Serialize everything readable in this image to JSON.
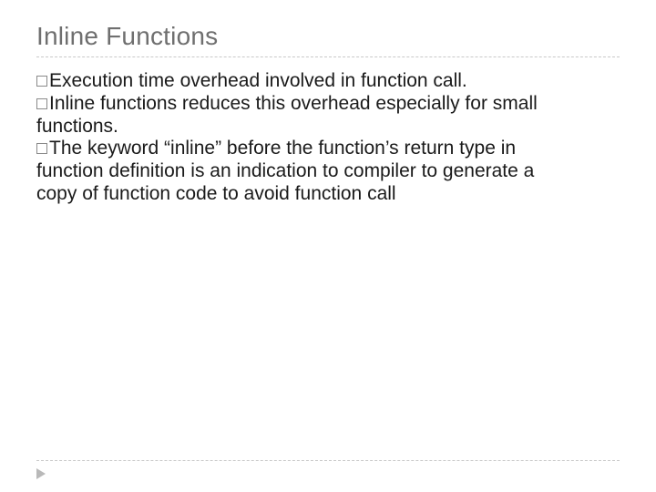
{
  "title": "Inline Functions",
  "bullets": [
    {
      "lead": "Execution",
      "rest": " time overhead involved in function call."
    },
    {
      "lead": "Inline",
      "rest": " functions reduces this overhead especially for small functions."
    },
    {
      "lead": "The",
      "rest": " keyword “inline” before the function’s return type in function definition is an indication to compiler to generate a copy of function code to avoid function call"
    }
  ]
}
